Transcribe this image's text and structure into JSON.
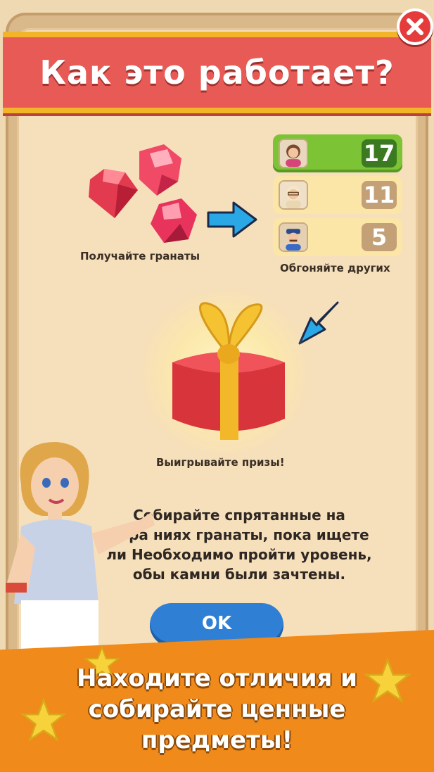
{
  "dialog": {
    "title": "Как это работает?",
    "close_icon": "close-icon"
  },
  "steps": {
    "collect_caption": "Получайте гранаты",
    "overtake_caption": "Обгоняйте других",
    "win_caption": "Выигрывайте призы!"
  },
  "leaderboard": [
    {
      "avatar": "woman-avatar-icon",
      "score": "17"
    },
    {
      "avatar": "old-man-avatar-icon",
      "score": "11"
    },
    {
      "avatar": "man-cap-avatar-icon",
      "score": "5"
    }
  ],
  "description": "Собирайте спрятанные на ...бра...ниях гранаты, пока ищете ...ия! Необходимо пройти уровень, ...обы камни были зачтены.",
  "description_lines": [
    "Собирайте спрятанные на",
    "обра  ниях гранаты, пока ищете",
    "ли  Необходимо пройти уровень,",
    "обы камни были зачтены."
  ],
  "ok_button": "OK",
  "promo": {
    "line1": "Находите отличия и",
    "line2": "собирайте ценные",
    "line3": "предметы!"
  },
  "colors": {
    "banner": "#e85a55",
    "banner_border": "#f2b52a",
    "leader_green": "#7cc436",
    "ok_blue": "#2f7fd4",
    "promo_orange": "#f08a1a",
    "arrow_blue": "#2aa8e6"
  }
}
